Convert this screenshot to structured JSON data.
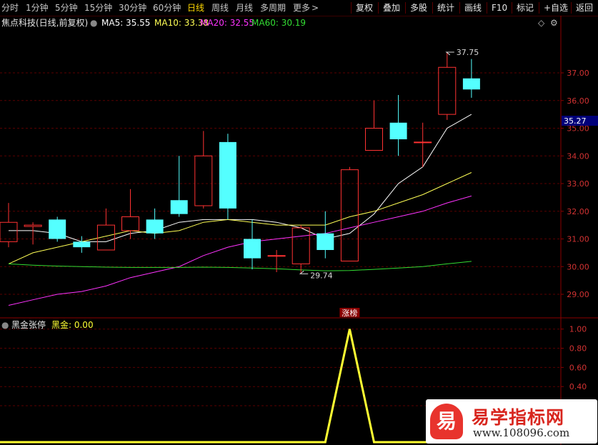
{
  "toolbar": {
    "periods": [
      "分时",
      "1分钟",
      "5分钟",
      "15分钟",
      "30分钟",
      "60分钟",
      "日线",
      "周线",
      "月线",
      "多周期",
      "更多"
    ],
    "active_period": "日线",
    "more_arrow": ">",
    "right_buttons": [
      "复权",
      "叠加",
      "多股",
      "统计",
      "画线",
      "F10",
      "标记",
      "+自选",
      "返回"
    ]
  },
  "main_panel": {
    "stock_name": "焦点科技(日线,前复权)",
    "ma_labels": [
      {
        "text": "MA5: 35.55",
        "color": "#ffffff"
      },
      {
        "text": "MA10: 33.38",
        "color": "#ffff55"
      },
      {
        "text": "MA20: 32.55",
        "color": "#ff33ff"
      },
      {
        "text": "MA60: 30.19",
        "color": "#33dd33"
      }
    ],
    "corner_icons": [
      "diamond-icon",
      "settings-icon"
    ],
    "event_tag": "涨榜",
    "current_price_tag": "35.27"
  },
  "sub_panel": {
    "indicator_name": "黑金张停",
    "value_label": "黑金: 0.00",
    "value_color": "#ffff33"
  },
  "watermark": {
    "mark_char": "易",
    "title": "易学指标网",
    "url": "www.108096.com"
  },
  "chart_data": [
    {
      "type": "candlestick",
      "yaxis_ticks": [
        37.0,
        36.0,
        35.0,
        34.0,
        33.0,
        32.0,
        31.0,
        30.0,
        29.0
      ],
      "ylim": [
        28.2,
        38.6
      ],
      "grid": "horizontal dashed",
      "current_price": 35.27,
      "high_annotation": "37.75",
      "low_annotation": "29.74",
      "up_color": "#ff3232",
      "down_color": "#54ffff",
      "candles": [
        {
          "o": 30.9,
          "h": 32.3,
          "l": 30.7,
          "c": 31.6
        },
        {
          "o": 31.45,
          "h": 31.6,
          "l": 30.8,
          "c": 31.5
        },
        {
          "o": 31.7,
          "h": 31.8,
          "l": 30.9,
          "c": 31.0
        },
        {
          "o": 30.9,
          "h": 31.1,
          "l": 30.5,
          "c": 30.7
        },
        {
          "o": 30.6,
          "h": 32.1,
          "l": 30.6,
          "c": 31.5
        },
        {
          "o": 31.3,
          "h": 32.8,
          "l": 31.0,
          "c": 31.8
        },
        {
          "o": 31.7,
          "h": 32.1,
          "l": 31.0,
          "c": 31.2
        },
        {
          "o": 32.4,
          "h": 34.0,
          "l": 31.8,
          "c": 31.9
        },
        {
          "o": 32.2,
          "h": 34.9,
          "l": 32.1,
          "c": 34.0
        },
        {
          "o": 34.5,
          "h": 34.8,
          "l": 31.7,
          "c": 32.1
        },
        {
          "o": 31.0,
          "h": 31.7,
          "l": 29.9,
          "c": 30.3
        },
        {
          "o": 30.4,
          "h": 30.6,
          "l": 29.8,
          "c": 30.4
        },
        {
          "o": 30.1,
          "h": 31.5,
          "l": 29.74,
          "c": 31.4
        },
        {
          "o": 31.2,
          "h": 32.0,
          "l": 30.3,
          "c": 30.6
        },
        {
          "o": 30.2,
          "h": 33.6,
          "l": 30.2,
          "c": 33.5
        },
        {
          "o": 34.2,
          "h": 36.0,
          "l": 34.2,
          "c": 35.0
        },
        {
          "o": 35.2,
          "h": 36.2,
          "l": 34.0,
          "c": 34.6
        },
        {
          "o": 34.5,
          "h": 35.2,
          "l": 33.6,
          "c": 34.5
        },
        {
          "o": 35.5,
          "h": 37.75,
          "l": 35.3,
          "c": 37.2
        },
        {
          "o": 36.8,
          "h": 37.5,
          "l": 36.1,
          "c": 36.4
        }
      ],
      "series": [
        {
          "name": "MA5",
          "color": "#ffffff",
          "values": [
            31.3,
            31.3,
            31.2,
            30.9,
            30.9,
            31.2,
            31.3,
            31.6,
            31.7,
            31.7,
            31.7,
            31.6,
            31.4,
            31.0,
            31.2,
            31.9,
            33.0,
            33.6,
            35.0,
            35.5
          ]
        },
        {
          "name": "MA10",
          "color": "#ffff55",
          "values": [
            30.1,
            30.5,
            30.7,
            30.9,
            31.1,
            31.3,
            31.2,
            31.3,
            31.6,
            31.7,
            31.6,
            31.5,
            31.5,
            31.5,
            31.8,
            32.0,
            32.3,
            32.6,
            33.0,
            33.4
          ]
        },
        {
          "name": "MA20",
          "color": "#ff33ff",
          "values": [
            28.6,
            28.8,
            29.0,
            29.1,
            29.3,
            29.6,
            29.8,
            30.0,
            30.4,
            30.7,
            30.9,
            31.0,
            31.1,
            31.2,
            31.4,
            31.6,
            31.8,
            32.0,
            32.3,
            32.55
          ]
        },
        {
          "name": "MA60",
          "color": "#33dd33",
          "values": [
            30.1,
            30.05,
            30.02,
            30.0,
            29.98,
            29.97,
            29.97,
            29.97,
            29.98,
            29.97,
            29.95,
            29.92,
            29.88,
            29.85,
            29.86,
            29.9,
            29.95,
            30.0,
            30.1,
            30.19
          ]
        }
      ]
    },
    {
      "type": "line",
      "yaxis_ticks": [
        1.0,
        0.8,
        0.6,
        0.4,
        0.2
      ],
      "ylim": [
        -0.18,
        1.05
      ],
      "series": [
        {
          "name": "黑金",
          "color": "#ffff33",
          "values": [
            -0.18,
            -0.18,
            -0.18,
            -0.18,
            -0.18,
            -0.18,
            -0.18,
            -0.18,
            -0.18,
            -0.18,
            -0.18,
            -0.18,
            -0.18,
            -0.18,
            1.0,
            -0.18,
            -0.18,
            -0.18,
            -0.18,
            -0.18
          ]
        }
      ]
    }
  ]
}
